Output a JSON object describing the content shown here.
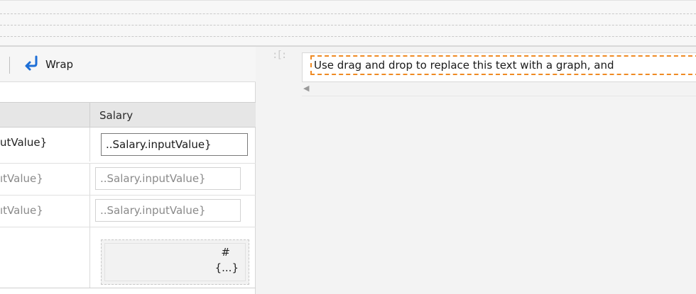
{
  "toolbar": {
    "wrap_label": "Wrap"
  },
  "grid": {
    "header_salary": "Salary",
    "rows": [
      {
        "left": "utValue}",
        "salary": "..Salary.inputValue}",
        "active": true
      },
      {
        "left": "ıtValue}",
        "salary": "..Salary.inputValue}",
        "active": false
      },
      {
        "left": "ıtValue}",
        "salary": "..Salary.inputValue}",
        "active": false
      }
    ],
    "calc": {
      "hash": "#",
      "braces": "{...}"
    }
  },
  "canvas": {
    "handle": ":[:",
    "placeholder_text": "Use drag and drop to replace this text with a graph, and"
  },
  "colors": {
    "accent_dash": "#ef8a23",
    "wrap_icon": "#1e6fd6"
  }
}
